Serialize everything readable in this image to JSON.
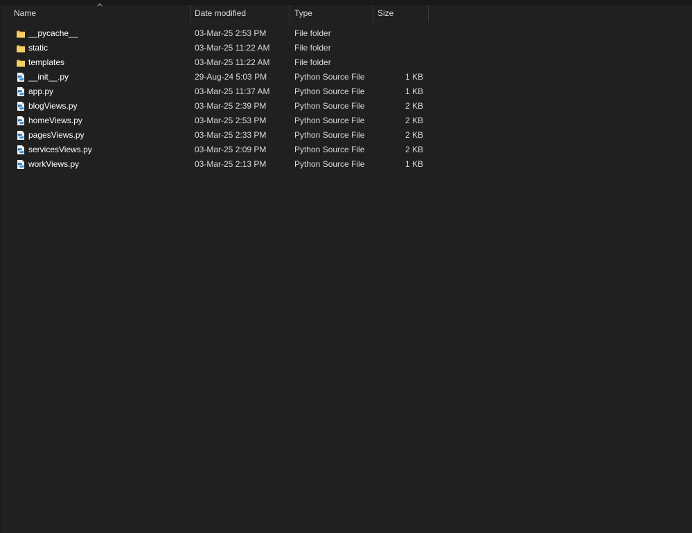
{
  "columns": {
    "name": "Name",
    "date": "Date modified",
    "type": "Type",
    "size": "Size"
  },
  "sort": {
    "column": "name",
    "direction": "ascending"
  },
  "colors": {
    "background": "#202020",
    "folder": "#f3c84a",
    "python_badge": "#2f78b7"
  },
  "files": [
    {
      "name": "__pycache__",
      "date": "03-Mar-25 2:53 PM",
      "type": "File folder",
      "size": "",
      "icon": "folder-icon"
    },
    {
      "name": "static",
      "date": "03-Mar-25 11:22 AM",
      "type": "File folder",
      "size": "",
      "icon": "folder-icon"
    },
    {
      "name": "templates",
      "date": "03-Mar-25 11:22 AM",
      "type": "File folder",
      "size": "",
      "icon": "folder-icon"
    },
    {
      "name": "__init__.py",
      "date": "29-Aug-24 5:03 PM",
      "type": "Python Source File",
      "size": "1 KB",
      "icon": "python-file-icon"
    },
    {
      "name": "app.py",
      "date": "03-Mar-25 11:37 AM",
      "type": "Python Source File",
      "size": "1 KB",
      "icon": "python-file-icon"
    },
    {
      "name": "blogViews.py",
      "date": "03-Mar-25 2:39 PM",
      "type": "Python Source File",
      "size": "2 KB",
      "icon": "python-file-icon"
    },
    {
      "name": "homeViews.py",
      "date": "03-Mar-25 2:53 PM",
      "type": "Python Source File",
      "size": "2 KB",
      "icon": "python-file-icon"
    },
    {
      "name": "pagesViews.py",
      "date": "03-Mar-25 2:33 PM",
      "type": "Python Source File",
      "size": "2 KB",
      "icon": "python-file-icon"
    },
    {
      "name": "servicesViews.py",
      "date": "03-Mar-25 2:09 PM",
      "type": "Python Source File",
      "size": "2 KB",
      "icon": "python-file-icon"
    },
    {
      "name": "workViews.py",
      "date": "03-Mar-25 2:13 PM",
      "type": "Python Source File",
      "size": "1 KB",
      "icon": "python-file-icon"
    }
  ]
}
